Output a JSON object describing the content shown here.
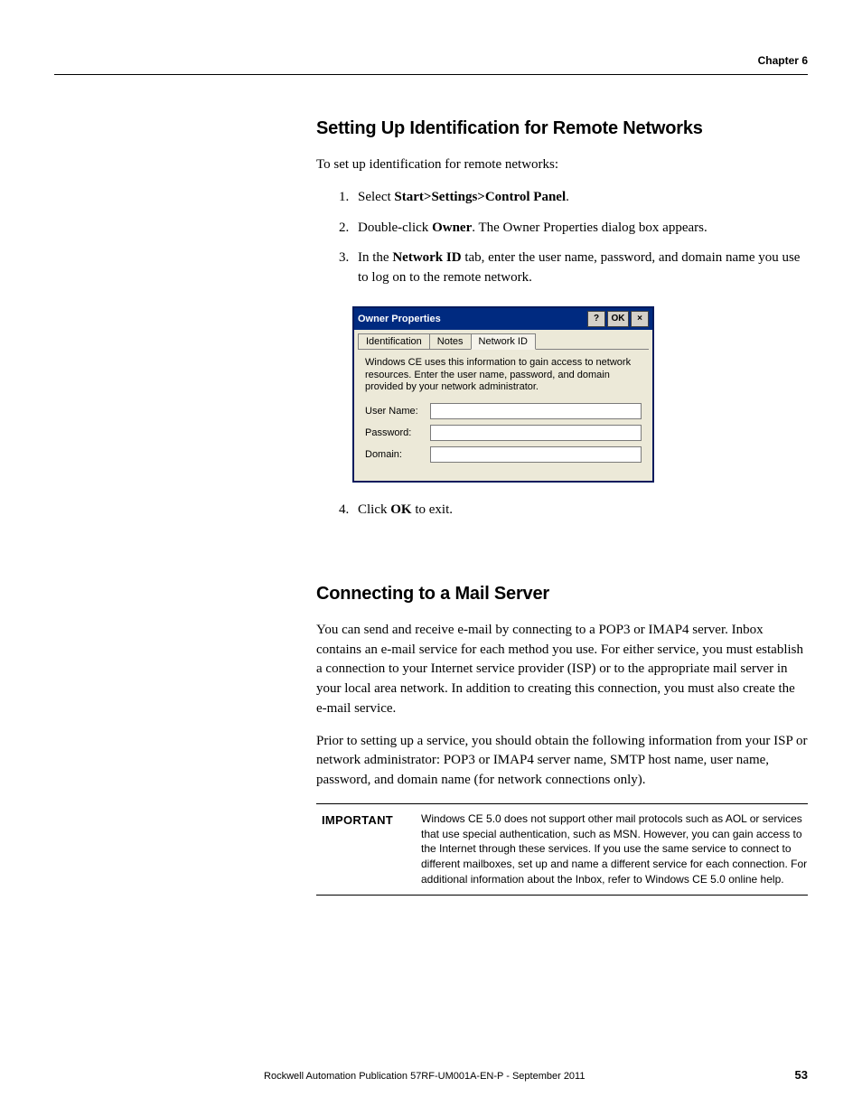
{
  "header": {
    "chapter_label": "Chapter 6"
  },
  "sections": {
    "s1": {
      "title": "Setting Up Identification for Remote Networks",
      "intro": "To set up identification for remote networks:",
      "step1_prefix": "Select ",
      "step1_bold": "Start>Settings>Control Panel",
      "step1_suffix": ".",
      "step2_prefix": "Double-click ",
      "step2_bold": "Owner",
      "step2_suffix": ". The Owner Properties dialog box appears.",
      "step3_prefix": "In the ",
      "step3_bold": "Network ID",
      "step3_suffix": " tab, enter the user name, password, and domain name you use to log on to the remote network.",
      "step4_prefix": "Click ",
      "step4_bold": "OK",
      "step4_suffix": " to exit."
    },
    "s2": {
      "title": "Connecting to a Mail Server",
      "p1": "You can send and receive e-mail by connecting to a POP3 or IMAP4 server. Inbox contains an e-mail service for each method you use. For either service, you must establish a connection to your Internet service provider (ISP) or to the appropriate mail server in your local area network. In addition to creating this connection, you must also create the e-mail service.",
      "p2": "Prior to setting up a service, you should obtain the following information from your ISP or network administrator: POP3 or IMAP4 server name, SMTP host name, user name, password, and domain name (for network connections only)."
    }
  },
  "dialog": {
    "title": "Owner Properties",
    "btn_help": "?",
    "btn_ok": "OK",
    "btn_close": "×",
    "tabs": {
      "t1": "Identification",
      "t2": "Notes",
      "t3": "Network ID"
    },
    "desc": "Windows CE uses this information to gain access to network resources. Enter the user name, password, and domain provided by your network administrator.",
    "labels": {
      "user": "User Name:",
      "pass": "Password:",
      "domain": "Domain:"
    },
    "values": {
      "user": "",
      "pass": "",
      "domain": ""
    }
  },
  "important": {
    "label": "IMPORTANT",
    "text": "Windows CE 5.0 does not support other mail protocols such as AOL or services that use special authentication, such as MSN. However, you can gain access to the Internet through these services. If you use the same service to connect to different mailboxes, set up and name a different service for each connection. For additional information about the Inbox, refer to Windows CE 5.0 online help."
  },
  "footer": {
    "publication": "Rockwell Automation Publication 57RF-UM001A-EN-P - September 2011",
    "page": "53"
  }
}
